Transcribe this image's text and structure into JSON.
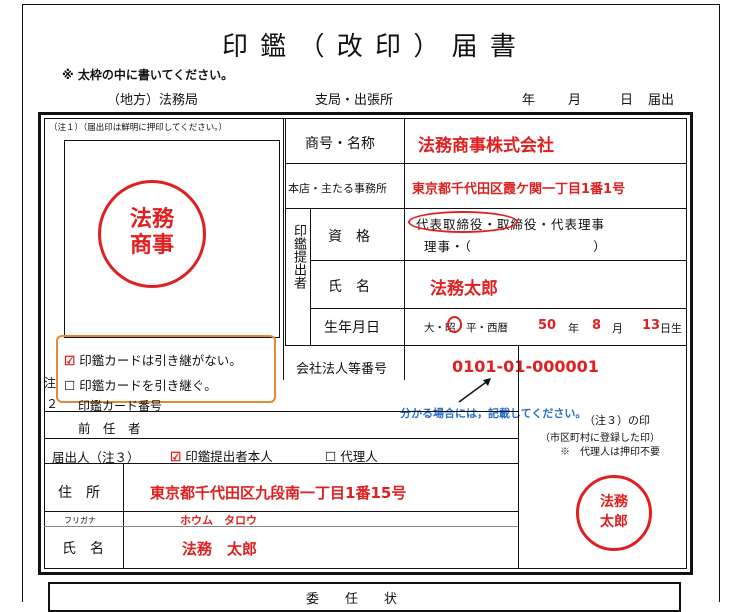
{
  "title": "印 鑑 （ 改 印 ） 届 書",
  "instruction": "※ 太枠の中に書いてください。",
  "header": {
    "bureau": "（地方）法務局",
    "branch": "支局・出張所",
    "year": "年",
    "month": "月",
    "day": "日",
    "submit": "届出"
  },
  "note1": "（注１）（届出印は鮮明に押印してください。）",
  "seal_company": [
    "法務",
    "商事"
  ],
  "fields": {
    "trade_name_label": "商号・名称",
    "trade_name_value": "法務商事株式会社",
    "hq_label": "本店・主たる事務所",
    "hq_value": "東京都千代田区霞ケ関一丁目1番1号",
    "applicant_label": "印鑑提出者",
    "qualification_label": "資　格",
    "qualification_line1": "代表取締役・取締役・代表理事",
    "qualification_line2": "理事・（　　　　　　　　　）",
    "name_label": "氏　名",
    "name_value": "法務太郎",
    "dob_label": "生年月日",
    "dob_era": "大・昭・平・西暦",
    "dob_year": "50",
    "dob_year_unit": "年",
    "dob_month": "8",
    "dob_month_unit": "月",
    "dob_day": "13",
    "dob_day_unit": "日生",
    "corp_no_label": "会社法人等番号",
    "corp_no_value": "0101-01-000001",
    "corp_no_note": "分かる場合には，記載してください。"
  },
  "card": {
    "option1": "印鑑カードは引き継がない。",
    "option2": "印鑑カードを引き継ぐ。",
    "card_number_label": "印鑑カード番号",
    "predecessor_label": "前　任　者",
    "note2_a": "注",
    "note2_b": "２"
  },
  "submitter": {
    "label": "届出人（注３）",
    "self": "印鑑提出者本人",
    "agent": "代理人",
    "address_label": "住　所",
    "address_value": "東京都千代田区九段南一丁目1番15号",
    "furigana_label": "フリガナ",
    "furigana_value": "ホウム　タロウ",
    "name_label": "氏　名",
    "name_value": "法務　太郎"
  },
  "seal_box": {
    "title": "（注３）の印",
    "note1": "（市区町村に登録した印）",
    "note2": "※　代理人は押印不要",
    "seal": [
      "法務",
      "太郎"
    ]
  },
  "footer": "委　　任　　状",
  "colors": {
    "red": "#e02020",
    "orange": "#e08a3a",
    "blue": "#2a6fc9"
  }
}
